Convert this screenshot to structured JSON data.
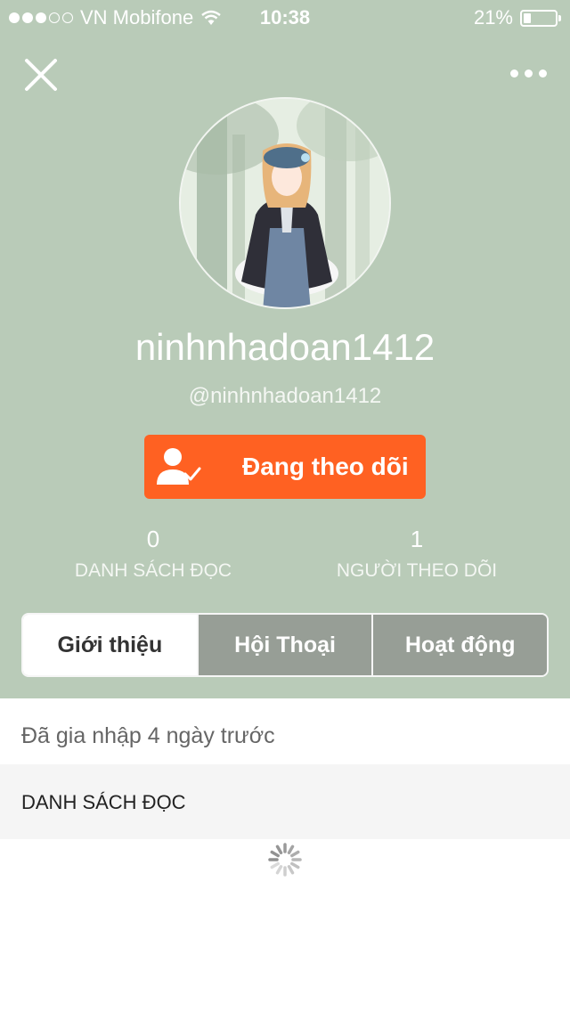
{
  "status_bar": {
    "carrier": "VN Mobifone",
    "time": "10:38",
    "battery": "21%",
    "battery_level": 0.21,
    "signal_bars": 3,
    "signal_total": 5,
    "wifi_icon": "wifi-icon"
  },
  "header": {
    "close_icon": "close-icon",
    "more_icon": "more-dots-icon",
    "background_color": "#b9cbb8"
  },
  "profile": {
    "username": "ninhnhadoan1412",
    "handle": "@ninhnhadoan1412",
    "follow_label": "Đang theo dõi",
    "follow_icon": "user-check-icon",
    "follow_color": "#ff6122"
  },
  "stats": [
    {
      "value": "0",
      "label": "DANH SÁCH ĐỌC"
    },
    {
      "value": "1",
      "label": "NGƯỜI THEO DÕI"
    }
  ],
  "tabs": [
    {
      "label": "Giới thiệu",
      "active": true
    },
    {
      "label": "Hội Thoại",
      "active": false
    },
    {
      "label": "Hoạt động",
      "active": false
    }
  ],
  "about": {
    "joined": "Đã gia nhập 4 ngày trước",
    "reading_list_title": "DANH SÁCH ĐỌC",
    "loading_icon": "loading-spinner-icon"
  }
}
